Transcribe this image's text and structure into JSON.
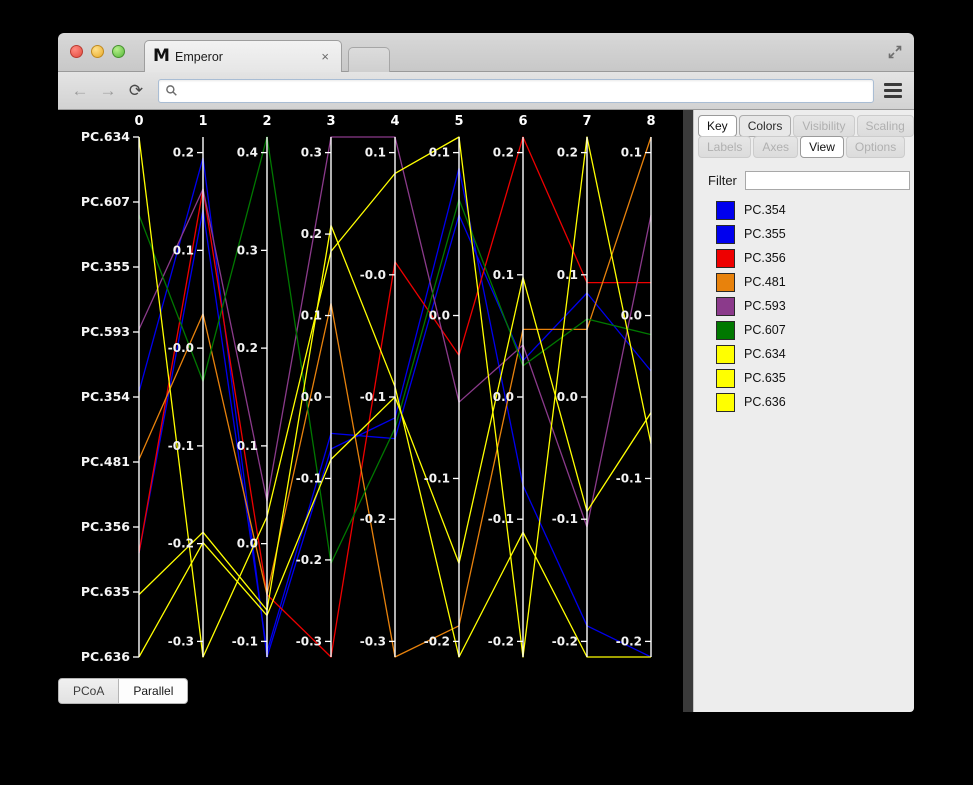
{
  "browser": {
    "tab_title": "Emperor",
    "tab_favicon": "M",
    "close_label": "×",
    "back_icon": "←",
    "forward_icon": "→",
    "reload_icon": "⟳",
    "omnibox_value": "",
    "omnibox_placeholder": ""
  },
  "view_toggle": {
    "buttons": [
      {
        "label": "PCoA",
        "active": false
      },
      {
        "label": "Parallel",
        "active": true
      }
    ]
  },
  "side_panel": {
    "tabs_row1": [
      {
        "label": "Key",
        "state": "active"
      },
      {
        "label": "Colors",
        "state": "semi"
      },
      {
        "label": "Visibility",
        "state": "disabled"
      },
      {
        "label": "Scaling",
        "state": "disabled"
      }
    ],
    "tabs_row2": [
      {
        "label": "Labels",
        "state": "disabled"
      },
      {
        "label": "Axes",
        "state": "disabled"
      },
      {
        "label": "View",
        "state": "active"
      },
      {
        "label": "Options",
        "state": "disabled"
      }
    ],
    "filter_label": "Filter",
    "filter_value": "",
    "filter_placeholder": "",
    "legend": [
      {
        "label": "PC.354",
        "color": "#0000ee"
      },
      {
        "label": "PC.355",
        "color": "#0000ee"
      },
      {
        "label": "PC.356",
        "color": "#ee0000"
      },
      {
        "label": "PC.481",
        "color": "#e8820c"
      },
      {
        "label": "PC.593",
        "color": "#8b3a8b"
      },
      {
        "label": "PC.607",
        "color": "#007800"
      },
      {
        "label": "PC.634",
        "color": "#ffff00"
      },
      {
        "label": "PC.635",
        "color": "#ffff00"
      },
      {
        "label": "PC.636",
        "color": "#ffff00"
      }
    ]
  },
  "chart_data": {
    "type": "line",
    "subtype": "parallel-coordinates",
    "title": "",
    "background": "#000000",
    "grid": false,
    "legend_position": "right-panel",
    "axis_headers": [
      "0",
      "1",
      "2",
      "3",
      "4",
      "5",
      "6",
      "7",
      "8"
    ],
    "category_axis_labels": [
      "PC.634",
      "PC.607",
      "PC.355",
      "PC.593",
      "PC.354",
      "PC.481",
      "PC.356",
      "PC.635",
      "PC.636"
    ],
    "axis_ticks": [
      {
        "axis": "0",
        "labels": [
          "PC.634",
          "PC.607",
          "PC.355",
          "PC.593",
          "PC.354",
          "PC.481",
          "PC.356",
          "PC.635",
          "PC.636"
        ]
      },
      {
        "axis": "1",
        "labels": [
          "0.2",
          "0.1",
          "-0.0",
          "-0.1",
          "-0.2",
          "-0.3"
        ]
      },
      {
        "axis": "2",
        "labels": [
          "0.4",
          "0.3",
          "0.2",
          "0.1",
          "0.0",
          "-0.1"
        ]
      },
      {
        "axis": "3",
        "labels": [
          "0.3",
          "0.2",
          "0.1",
          "0.0",
          "-0.1",
          "-0.2",
          "-0.3"
        ]
      },
      {
        "axis": "4",
        "labels": [
          "0.1",
          "-0.0",
          "-0.1",
          "-0.2",
          "-0.3"
        ]
      },
      {
        "axis": "5",
        "labels": [
          "0.1",
          "0.0",
          "-0.1",
          "-0.2"
        ]
      },
      {
        "axis": "6",
        "labels": [
          "0.2",
          "0.1",
          "0.0",
          "-0.1",
          "-0.2"
        ]
      },
      {
        "axis": "7",
        "labels": [
          "0.2",
          "0.1",
          "0.0",
          "-0.1",
          "-0.2"
        ]
      },
      {
        "axis": "8",
        "labels": [
          "0.1",
          "0.0",
          "-0.1",
          "-0.2"
        ]
      }
    ],
    "series": [
      {
        "name": "PC.354",
        "color": "#0000ee",
        "values": [
          0.51,
          0.96,
          0.0,
          0.4,
          0.46,
          0.94,
          0.33,
          0.06,
          0.0
        ]
      },
      {
        "name": "PC.355",
        "color": "#0000ee",
        "values": [
          0.2,
          0.86,
          0.01,
          0.43,
          0.42,
          0.85,
          0.57,
          0.7,
          0.55
        ]
      },
      {
        "name": "PC.356",
        "color": "#ee0000",
        "values": [
          0.2,
          0.9,
          0.12,
          0.0,
          0.76,
          0.58,
          1.0,
          0.72,
          0.72
        ]
      },
      {
        "name": "PC.481",
        "color": "#e8820c",
        "values": [
          0.38,
          0.66,
          0.12,
          0.68,
          0.0,
          0.06,
          0.63,
          0.63,
          1.0
        ]
      },
      {
        "name": "PC.593",
        "color": "#8b3a8b",
        "values": [
          0.63,
          0.9,
          0.3,
          1.0,
          1.0,
          0.49,
          0.6,
          0.25,
          0.85
        ]
      },
      {
        "name": "PC.607",
        "color": "#007800",
        "values": [
          0.85,
          0.53,
          1.0,
          0.18,
          0.44,
          0.88,
          0.56,
          0.65,
          0.62
        ]
      },
      {
        "name": "PC.634",
        "color": "#ffff00",
        "values": [
          1.0,
          0.0,
          0.27,
          0.78,
          0.93,
          1.0,
          0.0,
          1.0,
          0.41
        ]
      },
      {
        "name": "PC.635",
        "color": "#ffff00",
        "values": [
          0.12,
          0.24,
          0.09,
          0.83,
          0.52,
          0.0,
          0.24,
          0.0,
          0.0
        ]
      },
      {
        "name": "PC.636",
        "color": "#ffff00",
        "values": [
          0.0,
          0.22,
          0.08,
          0.38,
          0.5,
          0.18,
          0.73,
          0.28,
          0.47
        ]
      }
    ]
  }
}
